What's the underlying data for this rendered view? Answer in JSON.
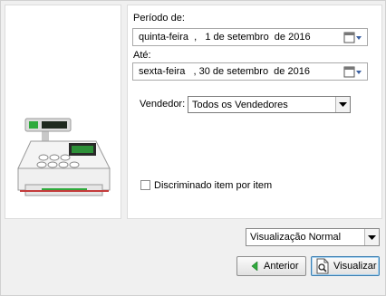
{
  "period": {
    "from_label": "Período de:",
    "from_value": "quinta-feira  ,   1 de setembro  de 2016",
    "to_label": "Até:",
    "to_value": "sexta-feira   , 30 de setembro  de 2016"
  },
  "seller": {
    "label": "Vendedor:",
    "selected": "Todos os Vendedores"
  },
  "detail_checkbox": {
    "label": "Discriminado item por item",
    "checked": false
  },
  "view_mode": {
    "selected": "Visualização Normal"
  },
  "buttons": {
    "back_label": "Anterior",
    "view_label": "Visualizar"
  },
  "colors": {
    "accent_green": "#2eaa3c",
    "focus_blue": "#3c7fb1"
  }
}
